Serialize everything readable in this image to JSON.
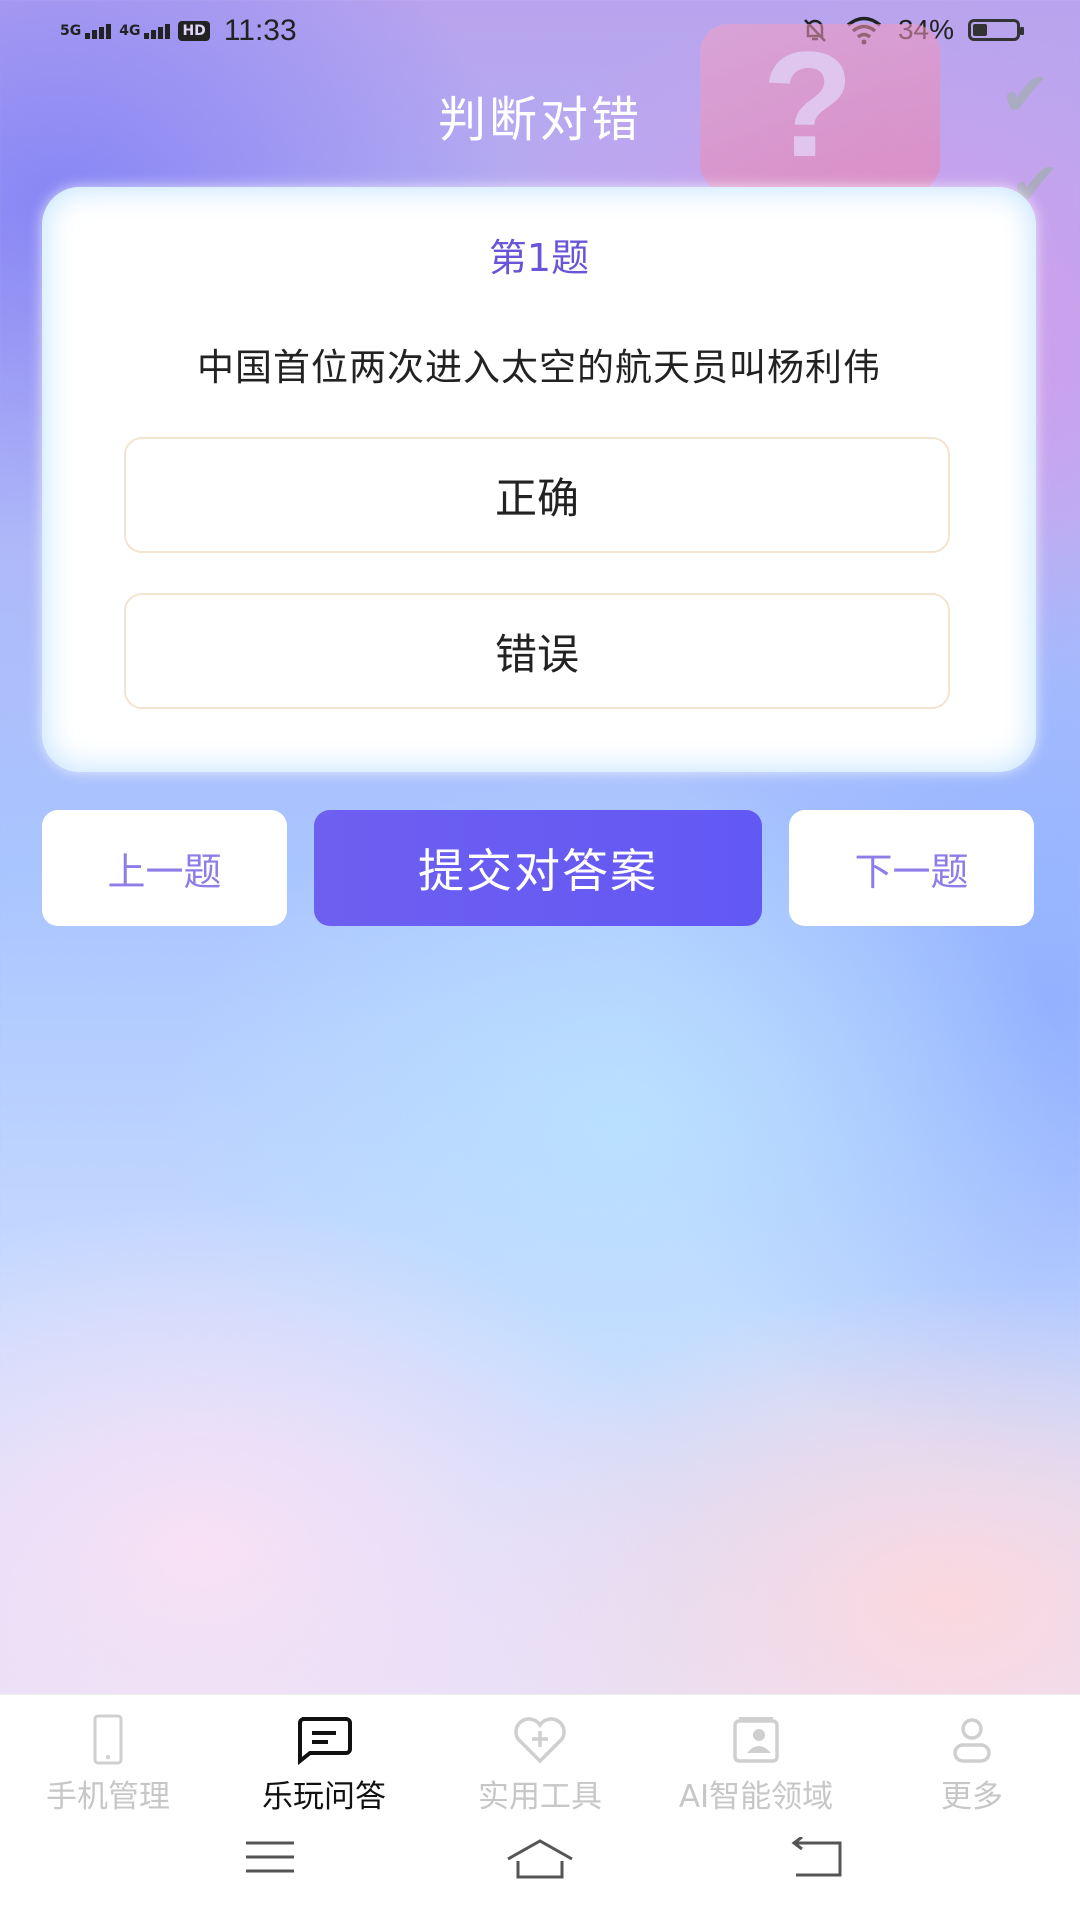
{
  "status_bar": {
    "network1": "5G",
    "network2": "4G",
    "hd": "HD",
    "time": "11:33",
    "battery_percent": "34%",
    "battery_level": 0.34
  },
  "page": {
    "title": "判断对错"
  },
  "question": {
    "number_label": "第1题",
    "text": "中国首位两次进入太空的航天员叫杨利伟",
    "options": [
      {
        "label": "正确"
      },
      {
        "label": "错误"
      }
    ]
  },
  "actions": {
    "prev_label": "上一题",
    "submit_label": "提交对答案",
    "next_label": "下一题"
  },
  "tab_bar": {
    "items": [
      {
        "label": "手机管理",
        "icon": "phone-icon",
        "active": false
      },
      {
        "label": "乐玩问答",
        "icon": "chat-icon",
        "active": true
      },
      {
        "label": "实用工具",
        "icon": "heart-plus-icon",
        "active": false
      },
      {
        "label": "AI智能领域",
        "icon": "ai-card-icon",
        "active": false
      },
      {
        "label": "更多",
        "icon": "person-icon",
        "active": false
      }
    ]
  },
  "colors": {
    "accent": "#6258f4",
    "question_number": "#6a55d8",
    "secondary_button_text": "#8f7ce8"
  }
}
